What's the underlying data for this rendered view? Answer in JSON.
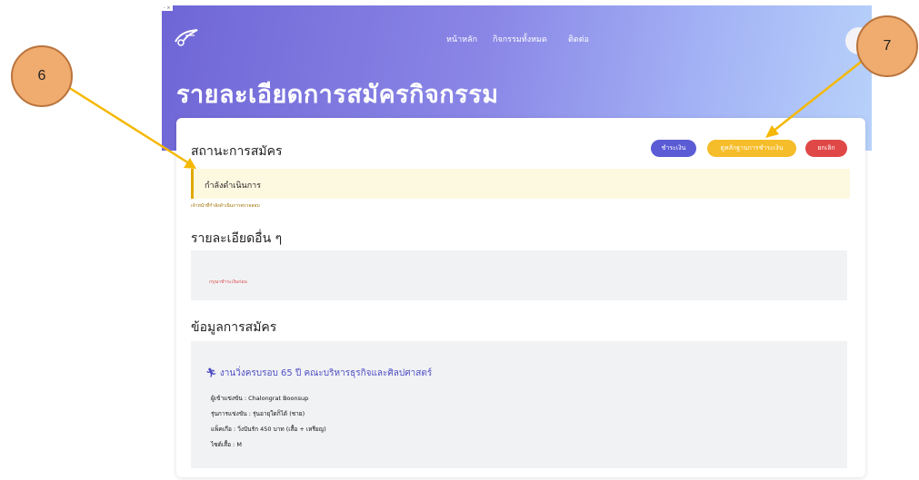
{
  "window": {
    "corner_text": "- ×"
  },
  "nav": {
    "items": [
      "หน้าหลัก",
      "กิจกรรมทั้งหมด",
      "ติดต่อ"
    ]
  },
  "header": {
    "title": "รายละเอียดการสมัครกิจกรรม"
  },
  "status_section": {
    "title": "สถานะการสมัคร",
    "status": "กำลังดำเนินการ",
    "note": "เจ้าหน้าที่กำลังดำเนินการตรวจสอบ",
    "buttons": {
      "pay": {
        "label": "ชำระเงิน",
        "color": "#5b5bd6"
      },
      "proof": {
        "label": "ดูหลักฐานการชำระเงิน",
        "color": "#f6bd2a"
      },
      "cancel": {
        "label": "ยกเลิก",
        "color": "#e04848"
      }
    }
  },
  "other_section": {
    "title": "รายละเอียดอื่น ๆ",
    "message": "กรุณาชำระเงินก่อน"
  },
  "application_section": {
    "title": "ข้อมูลการสมัคร",
    "activity_icon": "running-person-icon",
    "activity_name": "งานวิ่งครบรอบ 65 ปี คณะบริหารธุรกิจและศิลปศาสตร์",
    "participant": "ผู้เข้าแข่งขัน : Chalongrat Boonsup",
    "division": "รุ่นการแข่งขัน : รุ่นอายุใดก็ได้ (ชาย)",
    "package": "แพ็คเกือ : วิ่งปันรัก 450 บาท (เสื้อ + เหรียญ)",
    "shirt_size": "ไซต์เสื้อ : M"
  },
  "annotations": {
    "marker_6": "6",
    "marker_7": "7",
    "color": "#f5b800"
  }
}
